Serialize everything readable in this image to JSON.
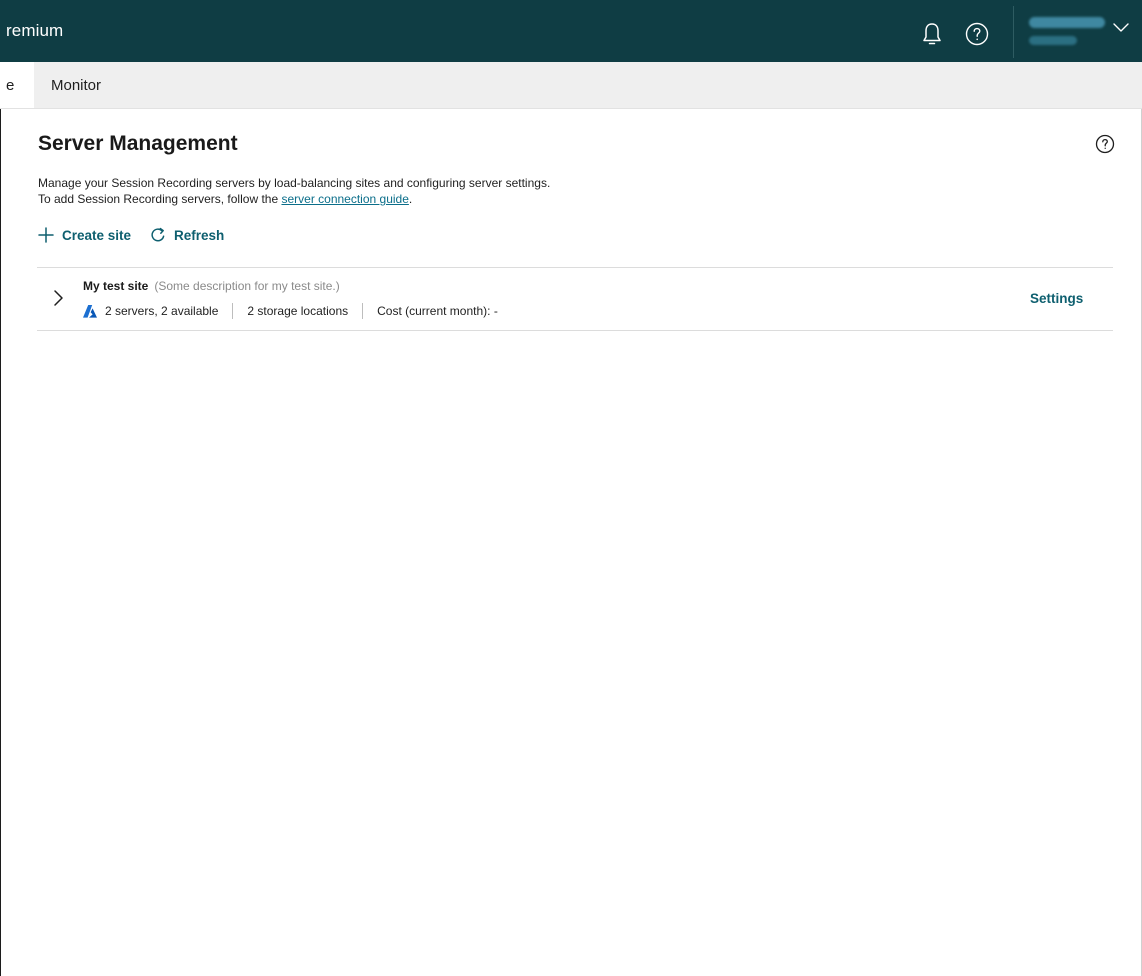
{
  "topbar": {
    "brand": "remium",
    "icons": [
      "bell-icon",
      "help-circle-icon",
      "chevron-down-icon"
    ],
    "colors": {
      "background": "#0f3d44",
      "text": "#ffffff"
    }
  },
  "nav": {
    "active_tab_fragment": "e",
    "tabs": [
      {
        "label": "Monitor"
      }
    ]
  },
  "page": {
    "title": "Server Management",
    "description_line1": "Manage your Session Recording servers by load-balancing sites and configuring server settings.",
    "description_line2_prefix": "To add Session Recording servers, follow the ",
    "description_link": "server connection guide",
    "description_line2_suffix": "."
  },
  "actions": {
    "create_site": "Create site",
    "refresh": "Refresh"
  },
  "sites": [
    {
      "name": "My test site",
      "description": "(Some description for my test site.)",
      "servers": "2 servers, 2 available",
      "storage": "2 storage locations",
      "cost": "Cost (current month): -",
      "settings_label": "Settings"
    }
  ],
  "accent_color": "#0e5f6f",
  "link_color": "#0b6e8a"
}
